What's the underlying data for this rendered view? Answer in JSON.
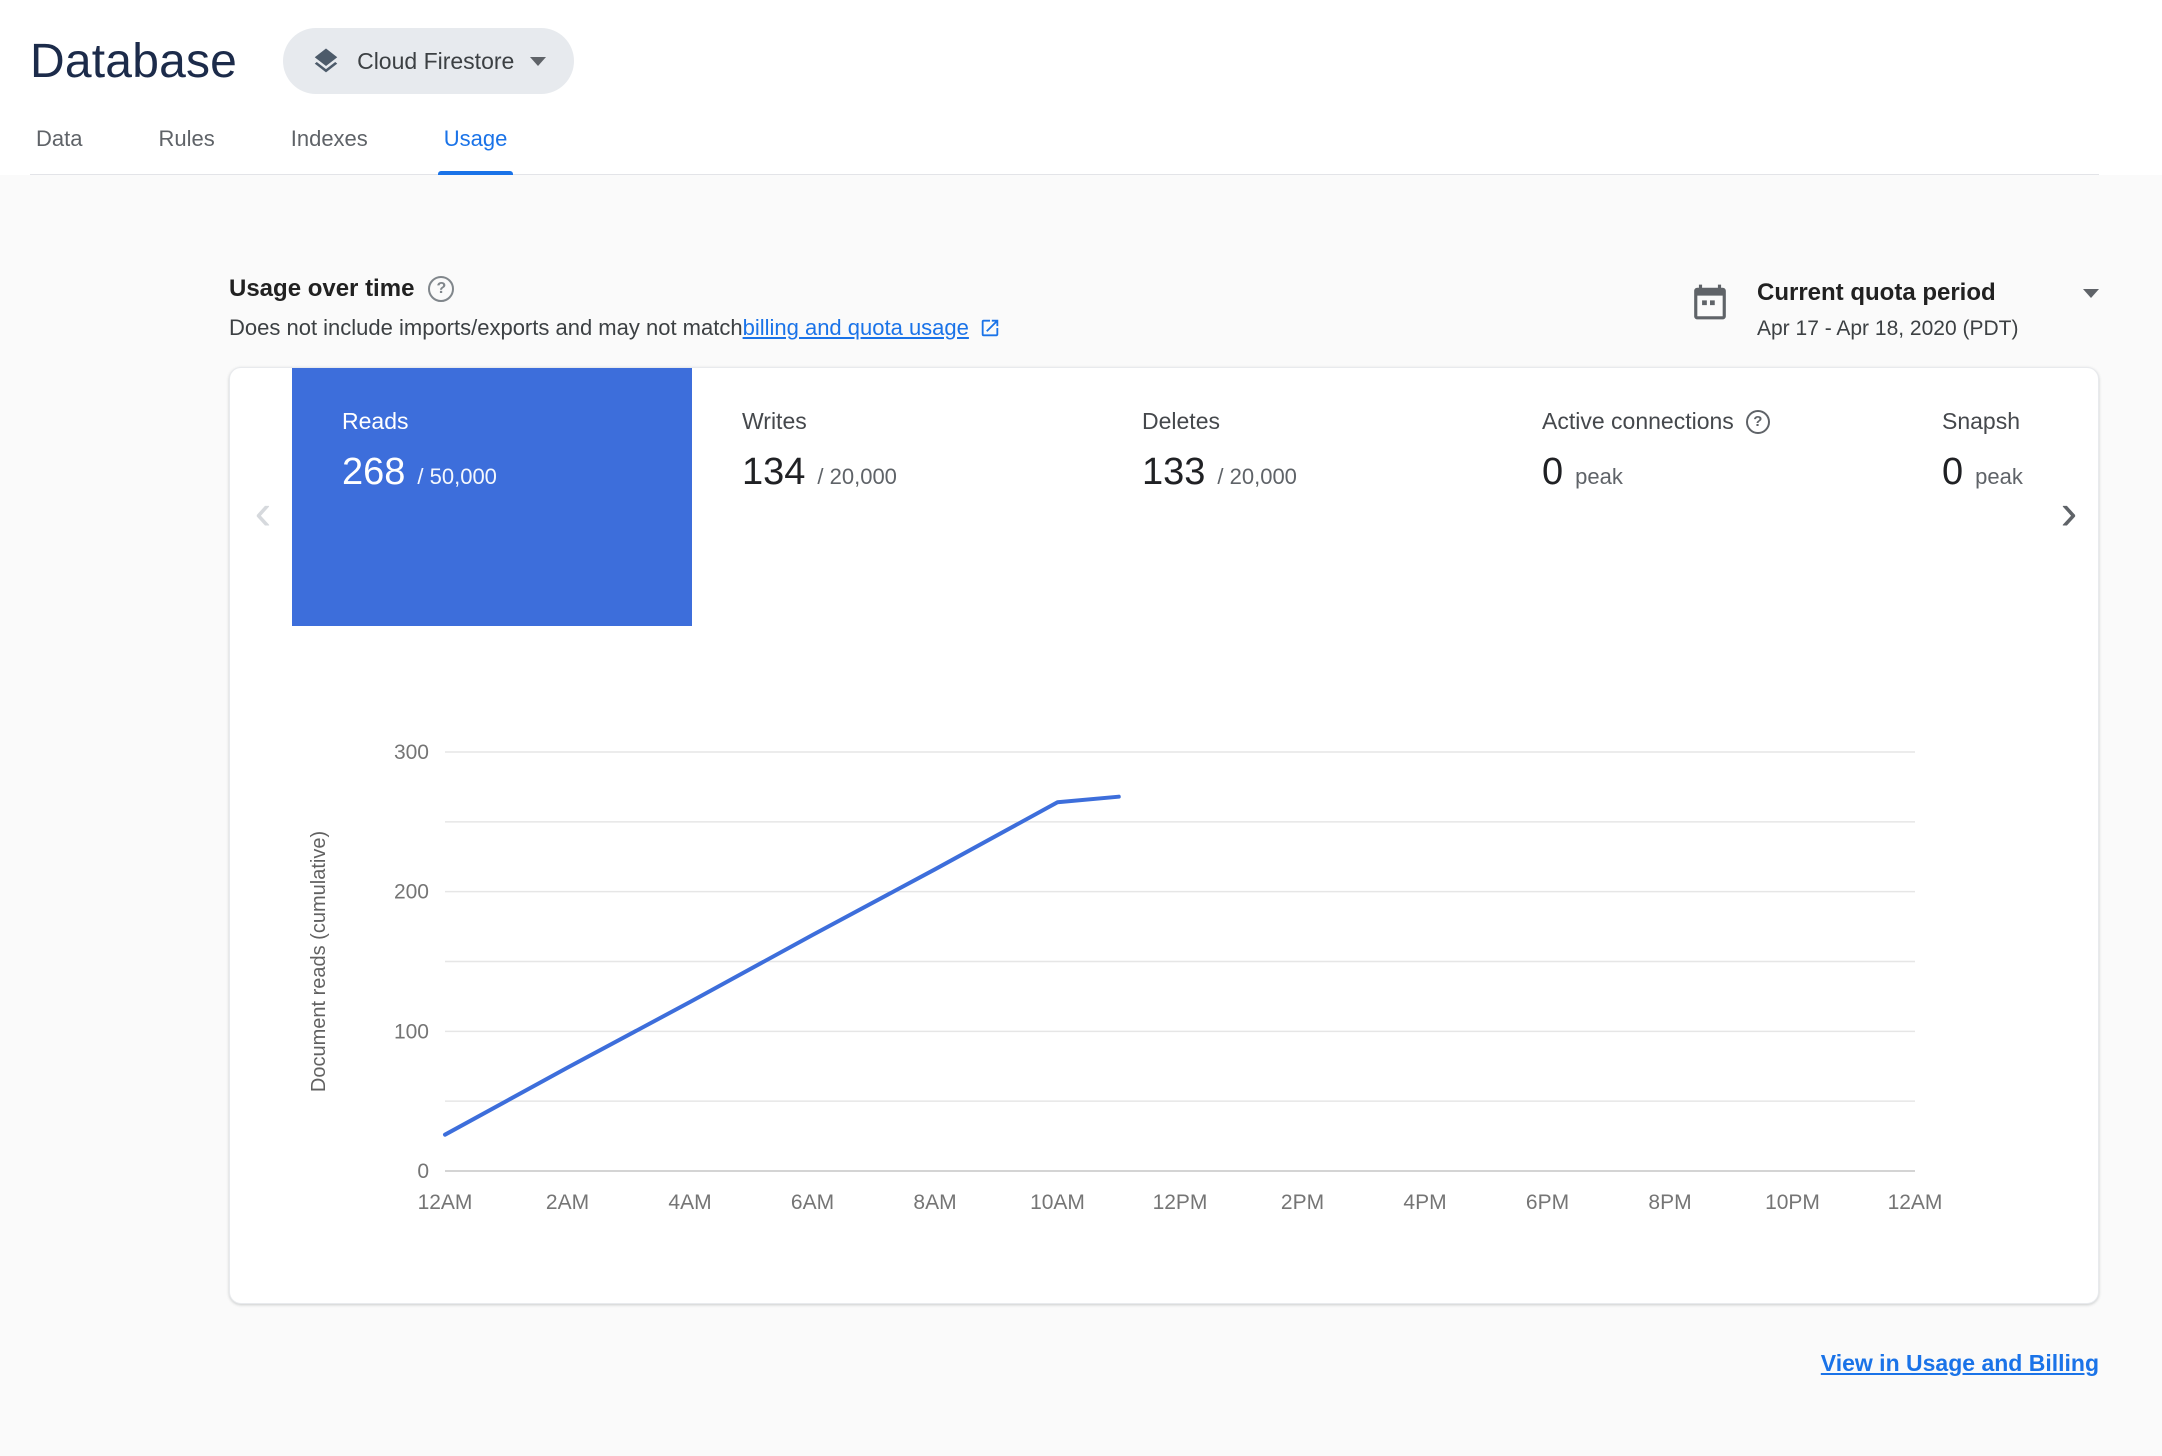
{
  "header": {
    "title": "Database",
    "product_selector": {
      "label": "Cloud Firestore"
    }
  },
  "tabs": [
    {
      "label": "Data",
      "active": false
    },
    {
      "label": "Rules",
      "active": false
    },
    {
      "label": "Indexes",
      "active": false
    },
    {
      "label": "Usage",
      "active": true
    }
  ],
  "usage_section": {
    "title": "Usage over time",
    "subtitle_prefix": "Does not include imports/exports and may not match ",
    "subtitle_link": "billing and quota usage",
    "period_selector": {
      "label": "Current quota period",
      "range": "Apr 17 - Apr 18, 2020 (PDT)"
    }
  },
  "metrics": [
    {
      "label": "Reads",
      "value": "268",
      "denominator": "/ 50,000",
      "selected": true
    },
    {
      "label": "Writes",
      "value": "134",
      "denominator": "/ 20,000",
      "selected": false
    },
    {
      "label": "Deletes",
      "value": "133",
      "denominator": "/ 20,000",
      "selected": false
    },
    {
      "label": "Active connections",
      "value": "0",
      "denominator": "peak",
      "selected": false,
      "help": true
    },
    {
      "label": "Snapsh",
      "value": "0",
      "denominator": "peak",
      "selected": false
    }
  ],
  "chart_data": {
    "type": "line",
    "title": "",
    "xlabel": "",
    "ylabel": "Document reads (cumulative)",
    "x_tick_labels": [
      "12AM",
      "2AM",
      "4AM",
      "6AM",
      "8AM",
      "10AM",
      "12PM",
      "2PM",
      "4PM",
      "6PM",
      "8PM",
      "10PM",
      "12AM"
    ],
    "x_range_hours": [
      0,
      24
    ],
    "ylim": [
      0,
      300
    ],
    "y_major_ticks": [
      0,
      100,
      200,
      300
    ],
    "y_gridline_step": 50,
    "grid": true,
    "legend": "none",
    "series": [
      {
        "name": "Document reads (cumulative)",
        "color": "#3d6edb",
        "points": [
          [
            0,
            26
          ],
          [
            2,
            74
          ],
          [
            4,
            121
          ],
          [
            6,
            169
          ],
          [
            8,
            216
          ],
          [
            10,
            264
          ],
          [
            11,
            268
          ]
        ]
      }
    ]
  },
  "footer": {
    "link": "View in Usage and Billing"
  },
  "colors": {
    "accent_blue": "#1a73e8",
    "selected_tile_blue": "#3d6edb",
    "chart_line_blue": "#3d6edb",
    "content_bg": "#fafafa",
    "title_navy": "#1c2b4a"
  }
}
